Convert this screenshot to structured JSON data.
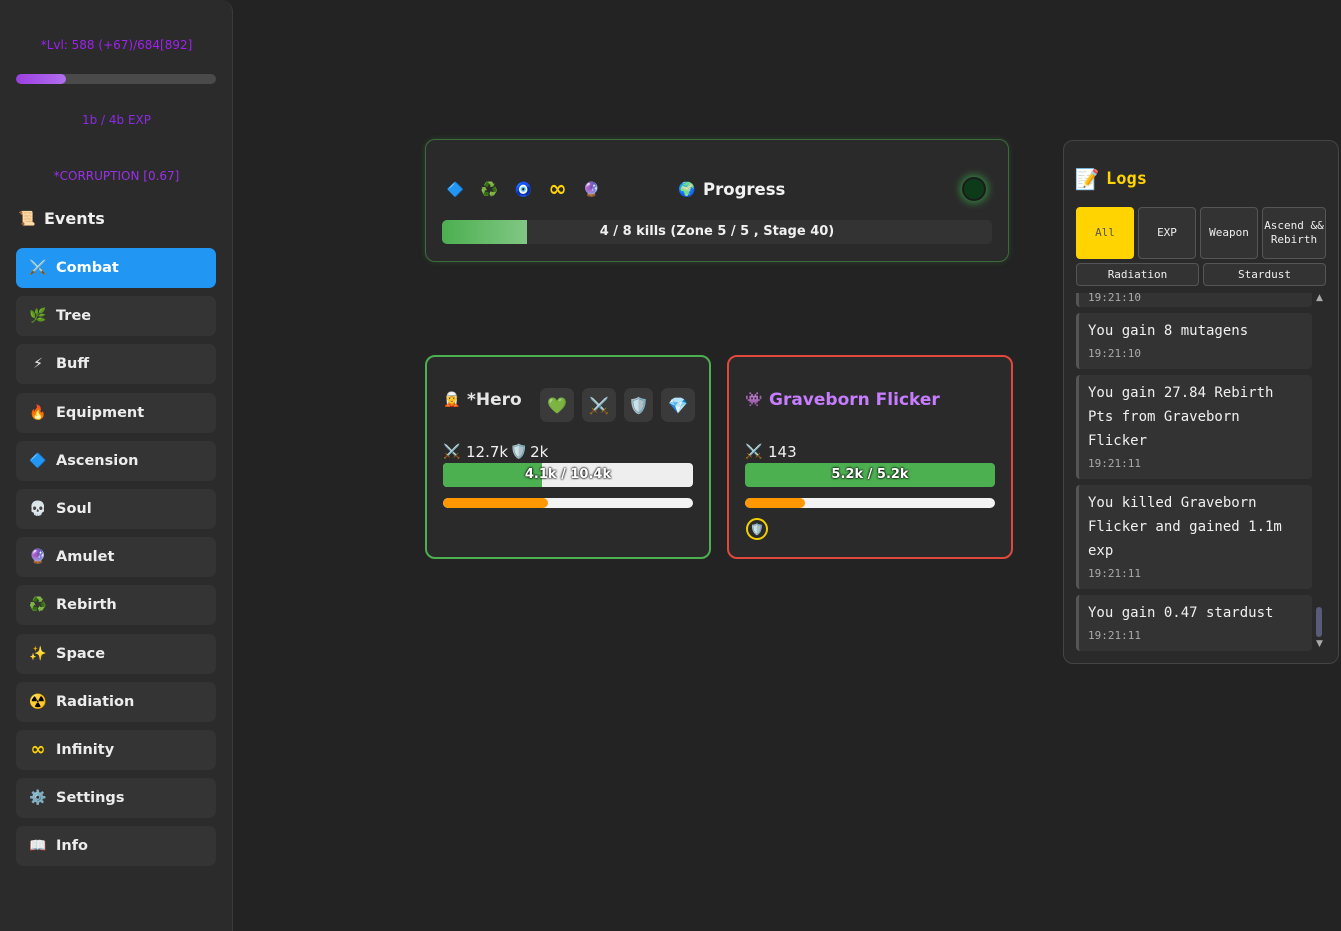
{
  "sidebar": {
    "level_text": "*Lvl: 588 (+67)/684[892]",
    "xp_progress": 0.25,
    "exp_text": "1b / 4b EXP",
    "corruption_text": "*CORRUPTION [0.67]",
    "events_title": "Events",
    "nav": [
      {
        "label": "Combat",
        "icon": "crossed-swords-icon",
        "active": true
      },
      {
        "label": "Tree",
        "icon": "leaf-icon"
      },
      {
        "label": "Buff",
        "icon": "lightning-icon"
      },
      {
        "label": "Equipment",
        "icon": "fire-icon"
      },
      {
        "label": "Ascension",
        "icon": "blue-gem-icon"
      },
      {
        "label": "Soul",
        "icon": "skull-icon"
      },
      {
        "label": "Amulet",
        "icon": "crystal-ball-icon"
      },
      {
        "label": "Rebirth",
        "icon": "recycle-icon"
      },
      {
        "label": "Space",
        "icon": "sparkles-icon"
      },
      {
        "label": "Radiation",
        "icon": "radioactive-icon"
      },
      {
        "label": "Infinity",
        "icon": "infinity-icon"
      },
      {
        "label": "Settings",
        "icon": "gear-icon"
      },
      {
        "label": "Info",
        "icon": "book-icon"
      }
    ]
  },
  "progress": {
    "title": "Progress",
    "bar_fraction": 0.155,
    "text": "4 / 8 kills (Zone 5 / 5 , Stage 40)"
  },
  "hero": {
    "name": "*Hero",
    "attack": "12.7k",
    "defense": "2k",
    "hp_text": "4.1k / 10.4k",
    "hp_fraction": 0.394,
    "attack_progress": 0.42,
    "buttons": [
      "heart-icon",
      "crossed-swords-icon",
      "shield-icon",
      "diamond-icon"
    ]
  },
  "enemy": {
    "name": "Graveborn Flicker",
    "attack": "143",
    "hp_text": "5.2k / 5.2k",
    "hp_fraction": 1.0,
    "attack_progress": 0.24
  },
  "logs": {
    "title": "Logs",
    "filters": [
      "All",
      "EXP",
      "Weapon",
      "Ascend && Rebirth"
    ],
    "filters2": [
      "Radiation",
      "Stardust"
    ],
    "entries": [
      {
        "msg": "You gain 8 mutagens",
        "time": "19:21:10"
      },
      {
        "msg": "You gain 27.84 Rebirth Pts from Graveborn Flicker",
        "time": "19:21:11"
      },
      {
        "msg": "You killed Graveborn Flicker and gained 1.1m exp",
        "time": "19:21:11"
      },
      {
        "msg": "You gain 0.47 stardust",
        "time": "19:21:11"
      }
    ]
  },
  "colors": {
    "accent": "#2196f3",
    "hero_border": "#4caf50",
    "enemy_border": "#e0483d",
    "logs_title": "#ffd400",
    "enemy_name": "#c77dff"
  }
}
